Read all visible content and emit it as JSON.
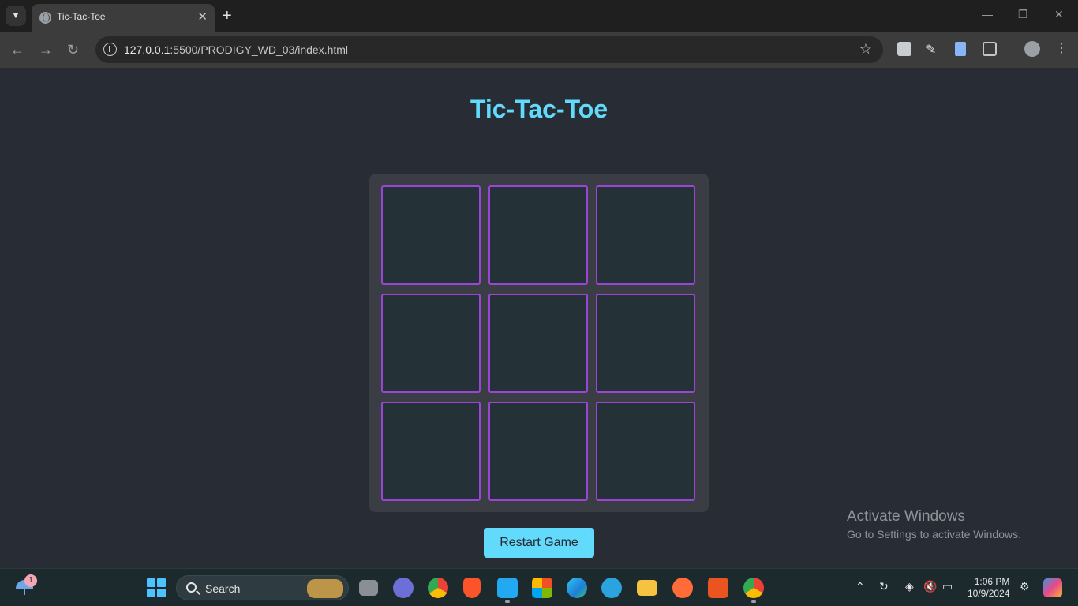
{
  "browser": {
    "tab_title": "Tic-Tac-Toe",
    "url_host": "127.0.0.1",
    "url_rest": ":5500/PRODIGY_WD_03/index.html"
  },
  "page": {
    "title": "Tic-Tac-Toe",
    "board": [
      "",
      "",
      "",
      "",
      "",
      "",
      "",
      "",
      ""
    ],
    "restart_label": "Restart Game",
    "colors": {
      "background": "#282c34",
      "accent": "#61dafb",
      "cell_border": "#9b45d6",
      "cell_fill": "#243136",
      "board_panel": "#3a3d44"
    }
  },
  "watermark": {
    "line1": "Activate Windows",
    "line2": "Go to Settings to activate Windows."
  },
  "taskbar": {
    "weather_badge": "1",
    "search_label": "Search",
    "apps": [
      "task-view",
      "video-call",
      "chrome",
      "brave",
      "vscode",
      "store",
      "edge",
      "telegram",
      "file-explorer",
      "postman",
      "ubuntu",
      "chrome-profile"
    ],
    "time": "1:06 PM",
    "date": "10/9/2024"
  }
}
